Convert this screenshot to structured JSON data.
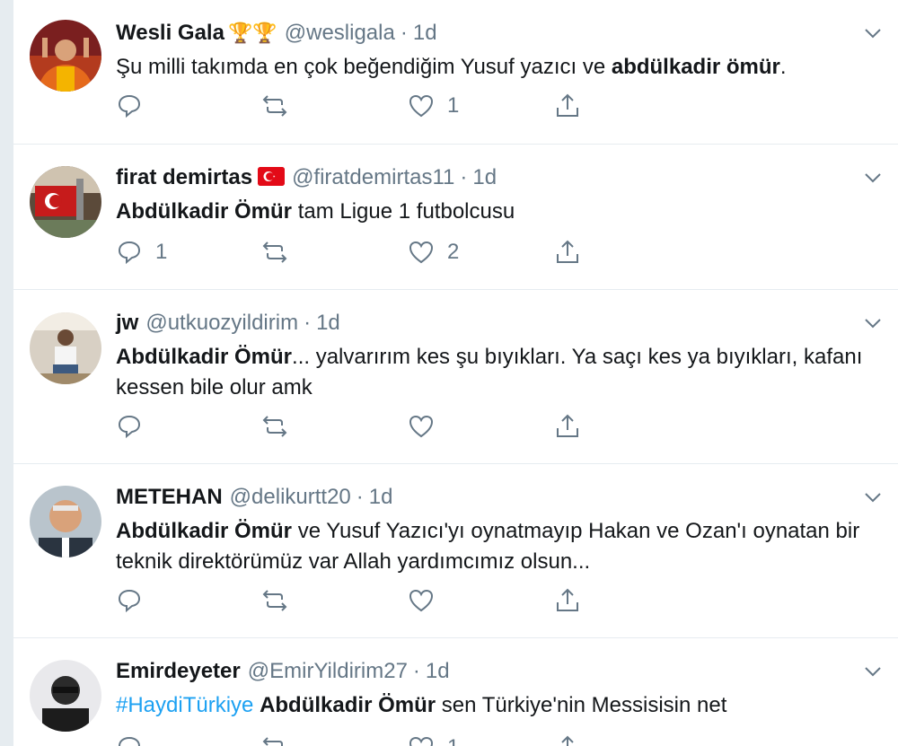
{
  "colors": {
    "accent": "#1da1f2",
    "muted": "#657786",
    "text": "#14171a"
  },
  "tweets": [
    {
      "name": "Wesli Gala",
      "emoji": "🏆🏆",
      "handle": "@wesligala",
      "sep": "·",
      "time": "1d",
      "text_parts": [
        {
          "text": "Şu milli takımda en çok beğendiğim Yusuf yazıcı ve ",
          "style": "normal"
        },
        {
          "text": "abdülkadir ömür",
          "style": "bold"
        },
        {
          "text": ".",
          "style": "normal"
        }
      ],
      "reply_count": "",
      "retweet_count": "",
      "like_count": "1"
    },
    {
      "name": "firat demirtas",
      "flag": "turkey-flag",
      "handle": "@firatdemirtas11",
      "sep": "·",
      "time": "1d",
      "text_parts": [
        {
          "text": "Abdülkadir Ömür",
          "style": "bold"
        },
        {
          "text": " tam Ligue 1 futbolcusu",
          "style": "normal"
        }
      ],
      "reply_count": "1",
      "retweet_count": "",
      "like_count": "2"
    },
    {
      "name": "jw",
      "handle": "@utkuozyildirim",
      "sep": "·",
      "time": "1d",
      "text_parts": [
        {
          "text": "Abdülkadir Ömür",
          "style": "bold"
        },
        {
          "text": "... yalvarırım kes şu bıyıkları. Ya saçı kes ya bıyıkları, kafanı kessen bile olur amk",
          "style": "normal"
        }
      ],
      "reply_count": "",
      "retweet_count": "",
      "like_count": ""
    },
    {
      "name": "METEHAN",
      "handle": "@delikurtt20",
      "sep": "·",
      "time": "1d",
      "text_parts": [
        {
          "text": "Abdülkadir Ömür",
          "style": "bold"
        },
        {
          "text": " ve Yusuf Yazıcı'yı oynatmayıp Hakan ve Ozan'ı oynatan bir teknik direktörümüz var Allah yardımcımız olsun...",
          "style": "normal"
        }
      ],
      "reply_count": "",
      "retweet_count": "",
      "like_count": ""
    },
    {
      "name": "Emirdeyeter",
      "handle": "@EmirYildirim27",
      "sep": "·",
      "time": "1d",
      "text_parts": [
        {
          "text": "#HaydiTürkiye",
          "style": "hashtag"
        },
        {
          "text": " ",
          "style": "normal"
        },
        {
          "text": "Abdülkadir Ömür",
          "style": "bold"
        },
        {
          "text": " sen Türkiye'nin Messisisin net",
          "style": "normal"
        }
      ],
      "reply_count": "",
      "retweet_count": "",
      "like_count": "1"
    }
  ]
}
